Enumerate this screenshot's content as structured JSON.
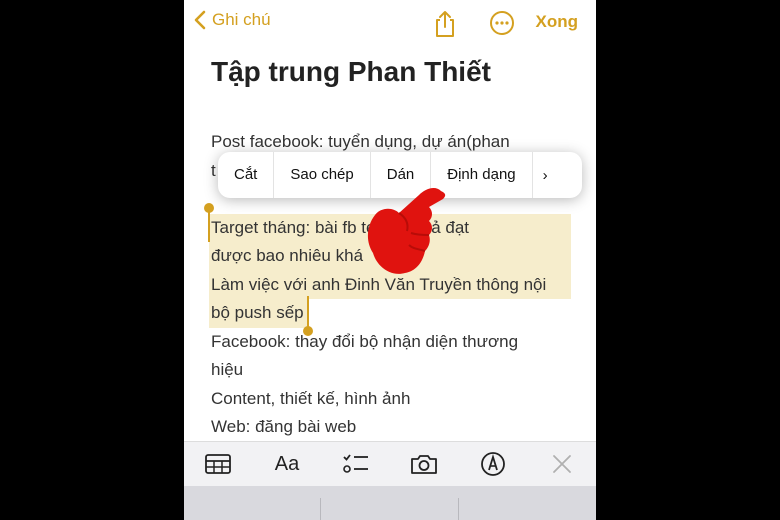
{
  "navbar": {
    "back_label": "Ghi chú",
    "done_label": "Xong",
    "share_icon": "share-icon",
    "more_icon": "ellipsis-circle-icon"
  },
  "note": {
    "title": "Tập trung Phan Thiết",
    "lines": [
      "Post facebook: tuyển dụng, dự án(phan",
      "t",
      "",
      "Target tháng: bài fb        te, kết quả đạt",
      "được bao nhiêu khá",
      "Làm việc với anh Đinh Văn Truyền thông nội",
      "bộ push sếp",
      "Facebook: thay đổi bộ nhận diện thương",
      "hiệu",
      "Content, thiết kế, hình ảnh",
      "Web: đăng bài web"
    ]
  },
  "context_menu": {
    "items": [
      "Cắt",
      "Sao chép",
      "Dán",
      "Định dạng"
    ],
    "more_label": "›"
  },
  "toolbar": {
    "format_label": "Aa",
    "icons": [
      "table-icon",
      "format-icon",
      "checklist-icon",
      "camera-icon",
      "markup-icon",
      "close-icon"
    ]
  },
  "colors": {
    "accent": "#d4a020",
    "selection": "#f6edcc",
    "finger": "#e0130f"
  }
}
